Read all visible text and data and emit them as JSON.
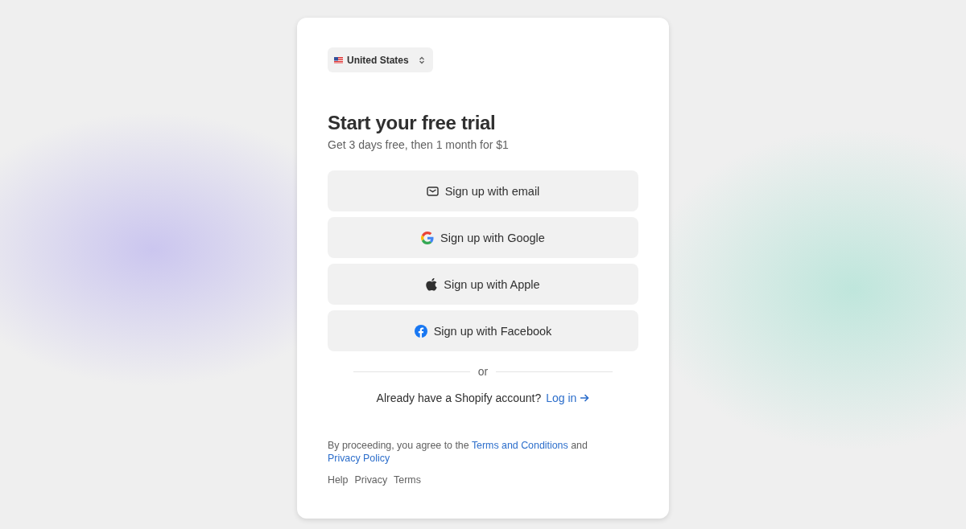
{
  "country": {
    "label": "United States"
  },
  "heading": "Start your free trial",
  "subheading": "Get 3 days free, then 1 month for $1",
  "buttons": [
    {
      "kind": "email",
      "label": "Sign up with email"
    },
    {
      "kind": "google",
      "label": "Sign up with Google"
    },
    {
      "kind": "apple",
      "label": "Sign up with Apple"
    },
    {
      "kind": "facebook",
      "label": "Sign up with Facebook"
    }
  ],
  "divider": "or",
  "login": {
    "prompt": "Already have a Shopify account?",
    "link": "Log in"
  },
  "legal": {
    "before": "By proceeding, you agree to the",
    "terms": "Terms and Conditions",
    "middle": "and",
    "privacy": "Privacy Policy"
  },
  "footer_links": [
    "Help",
    "Privacy",
    "Terms"
  ]
}
